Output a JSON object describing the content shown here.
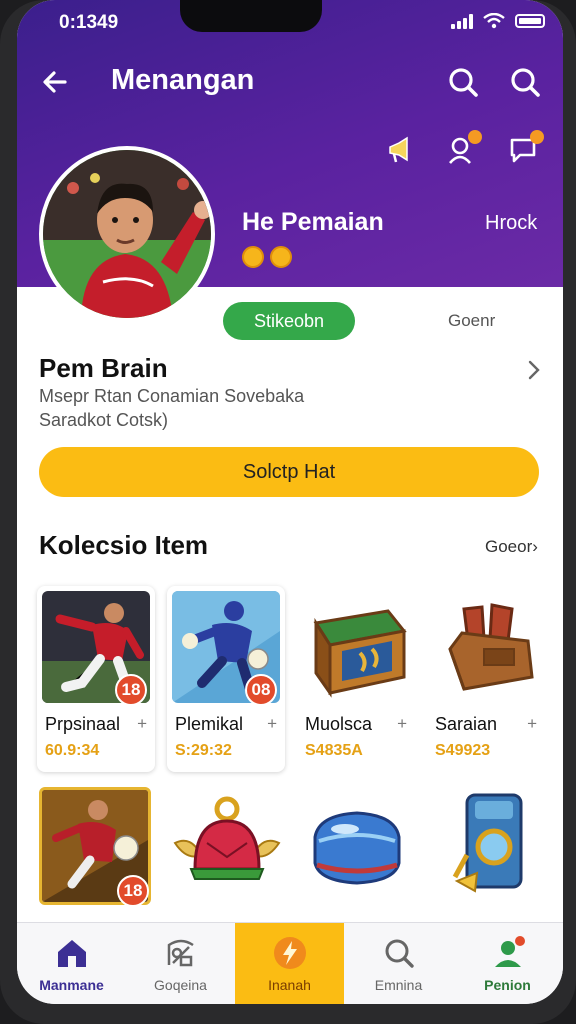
{
  "status": {
    "time": "0:1349"
  },
  "header": {
    "title": "Menangan"
  },
  "profile": {
    "player_name": "He Pemaian",
    "rank_text": "Hrock",
    "status_pill": "Stikeobn",
    "gender": "Goenr",
    "name": "Pem Brain",
    "desc_line1": "Msepr Rtan Conamian Sovebaka",
    "desc_line2": "Saradkot Cotsk)",
    "cta": "Solctp Hat"
  },
  "collection": {
    "title": "Kolecsio Item",
    "more": "Goeor",
    "items": [
      {
        "name": "Prpsinaal",
        "price": "60.9:34",
        "badge": "18",
        "add": "+"
      },
      {
        "name": "Plemikal",
        "price": "S:29:32",
        "badge": "08",
        "add": "+"
      },
      {
        "name": "Muolsca",
        "price": "S4835A",
        "add": "+"
      },
      {
        "name": "Saraian",
        "price": "S49923",
        "add": "+"
      }
    ],
    "row2_badge": "18"
  },
  "tabs": [
    {
      "label": "Manmane"
    },
    {
      "label": "Goqeina"
    },
    {
      "label": "Inanah"
    },
    {
      "label": "Emnina"
    },
    {
      "label": "Penion"
    }
  ],
  "colors": {
    "header_purple": "#4a21a0",
    "accent_yellow": "#fbbc13",
    "pill_green": "#34a84a",
    "badge_red": "#e24b2b"
  }
}
